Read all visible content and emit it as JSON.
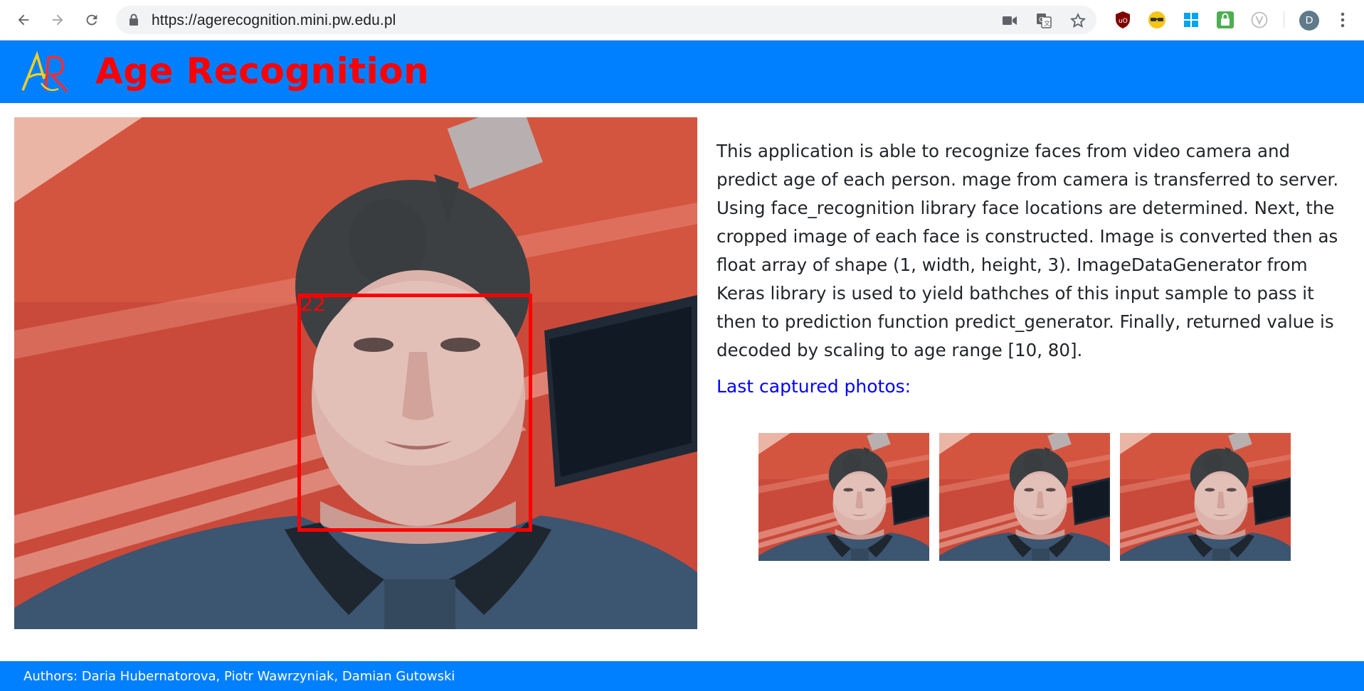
{
  "browser": {
    "url": "https://agerecognition.mini.pw.edu.pl",
    "profile_initial": "D",
    "icons": [
      "back-arrow-icon",
      "forward-arrow-icon",
      "reload-icon",
      "lock-icon",
      "camera-icon",
      "translate-icon",
      "star-icon",
      "ublock-icon",
      "glasses-extension-icon",
      "windows-extension-icon",
      "lock-extension-icon",
      "v-extension-icon",
      "menu-dots-icon"
    ]
  },
  "header": {
    "logo_text": "AR",
    "title": "Age Recognition",
    "background": "#0080ff",
    "title_color": "#ff0000"
  },
  "camera": {
    "predicted_age": "22",
    "box_color": "#ff0000"
  },
  "description": "This application is able to recognize faces from video camera and predict age of each person. mage from camera is transferred to server. Using face_recognition library face locations are determined. Next, the cropped image of each face is constructed. Image is converted then as float array of shape (1, width, height, 3). ImageDataGenerator from Keras library is used to yield bathches of this input sample to pass it then to prediction function predict_generator. Finally, returned value is decoded by scaling to age range [10, 80].",
  "captured": {
    "label": "Last captured photos:",
    "label_color": "#0000ff",
    "count": 3
  },
  "footer": {
    "authors": "Authors: Daria Hubernatorova, Piotr Wawrzyniak, Damian Gutowski"
  }
}
